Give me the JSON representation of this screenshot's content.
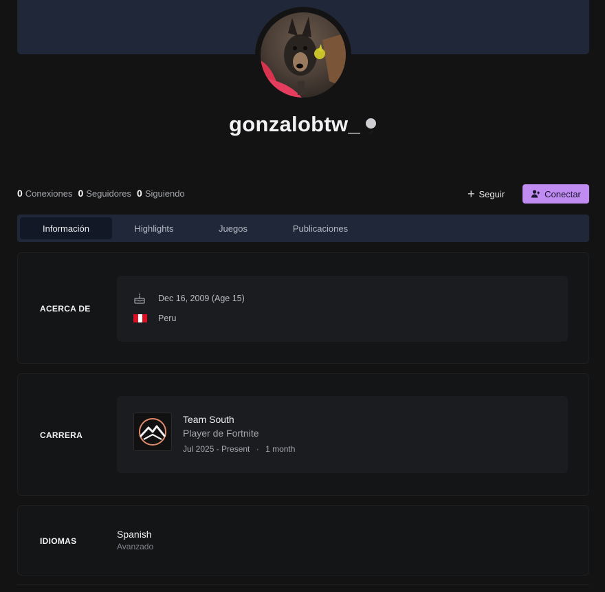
{
  "profile": {
    "username": "gonzalobtw_",
    "avatar_alt": "avatar"
  },
  "stats": [
    {
      "count": "0",
      "label": "Conexiones"
    },
    {
      "count": "0",
      "label": "Seguidores"
    },
    {
      "count": "0",
      "label": "Siguiendo"
    }
  ],
  "actions": {
    "follow_label": "Seguir",
    "connect_label": "Conectar"
  },
  "tabs": [
    {
      "label": "Información",
      "active": true
    },
    {
      "label": "Highlights",
      "active": false
    },
    {
      "label": "Juegos",
      "active": false
    },
    {
      "label": "Publicaciones",
      "active": false
    }
  ],
  "about": {
    "title": "ACERCA DE",
    "birthday": "Dec 16, 2009 (Age 15)",
    "country": "Peru",
    "icons": {
      "birthday": "cake-icon",
      "country": "peru-flag-icon"
    }
  },
  "career": {
    "title": "CARRERA",
    "org_name": "Team South",
    "role": "Player de Fortnite",
    "period": "Jul 2025 - Present",
    "separator": "·",
    "duration": "1 month"
  },
  "languages": {
    "title": "IDIOMAS",
    "items": [
      {
        "name": "Spanish",
        "level": "Avanzado"
      }
    ]
  },
  "colors": {
    "background": "#131314",
    "banner": "#1f2738",
    "accent_button": "#c08cf2",
    "card": "#141517",
    "inner_card": "#1b1c20"
  }
}
